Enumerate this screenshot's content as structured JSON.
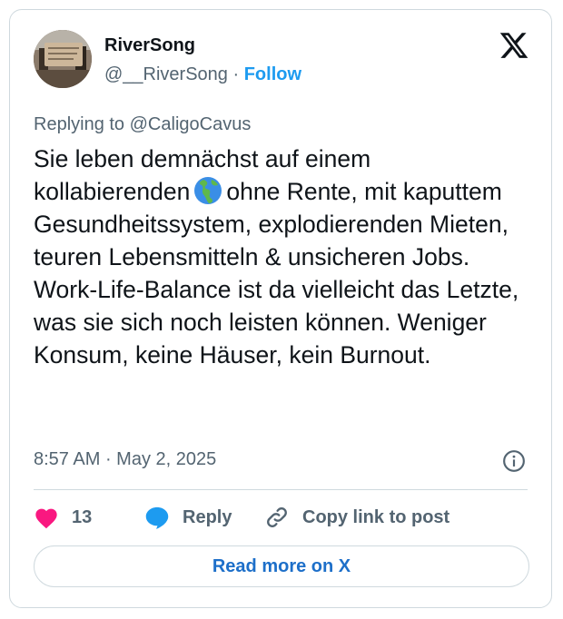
{
  "tweet": {
    "display_name": "RiverSong",
    "handle": "@__RiverSong",
    "separator": " · ",
    "follow_label": "Follow",
    "reply_prefix": "Replying to ",
    "reply_to": "@CaligoCavus",
    "text_before_emoji": "Sie leben demnächst auf einem kollabierenden",
    "emoji_name": "globe-europe-africa-icon",
    "text_after_emoji": "ohne Rente, mit kaputtem Gesundheitssystem, explodierenden Mieten, teuren Lebensmitteln & unsicheren Jobs. Work-Life-Balance ist da vielleicht das Letzte, was sie sich noch leisten können. Weniger Konsum, keine Häuser, kein Burnout.",
    "time": "8:57 AM",
    "date": "May 2, 2025"
  },
  "actions": {
    "like_count": "13",
    "reply_label": "Reply",
    "copy_link_label": "Copy link to post"
  },
  "read_more_label": "Read more on X",
  "colors": {
    "like": "#f91880",
    "reply": "#1d9bf0",
    "follow": "#1d9bf0",
    "muted": "#536471",
    "text": "#0f1419",
    "border": "#cfd9de"
  }
}
